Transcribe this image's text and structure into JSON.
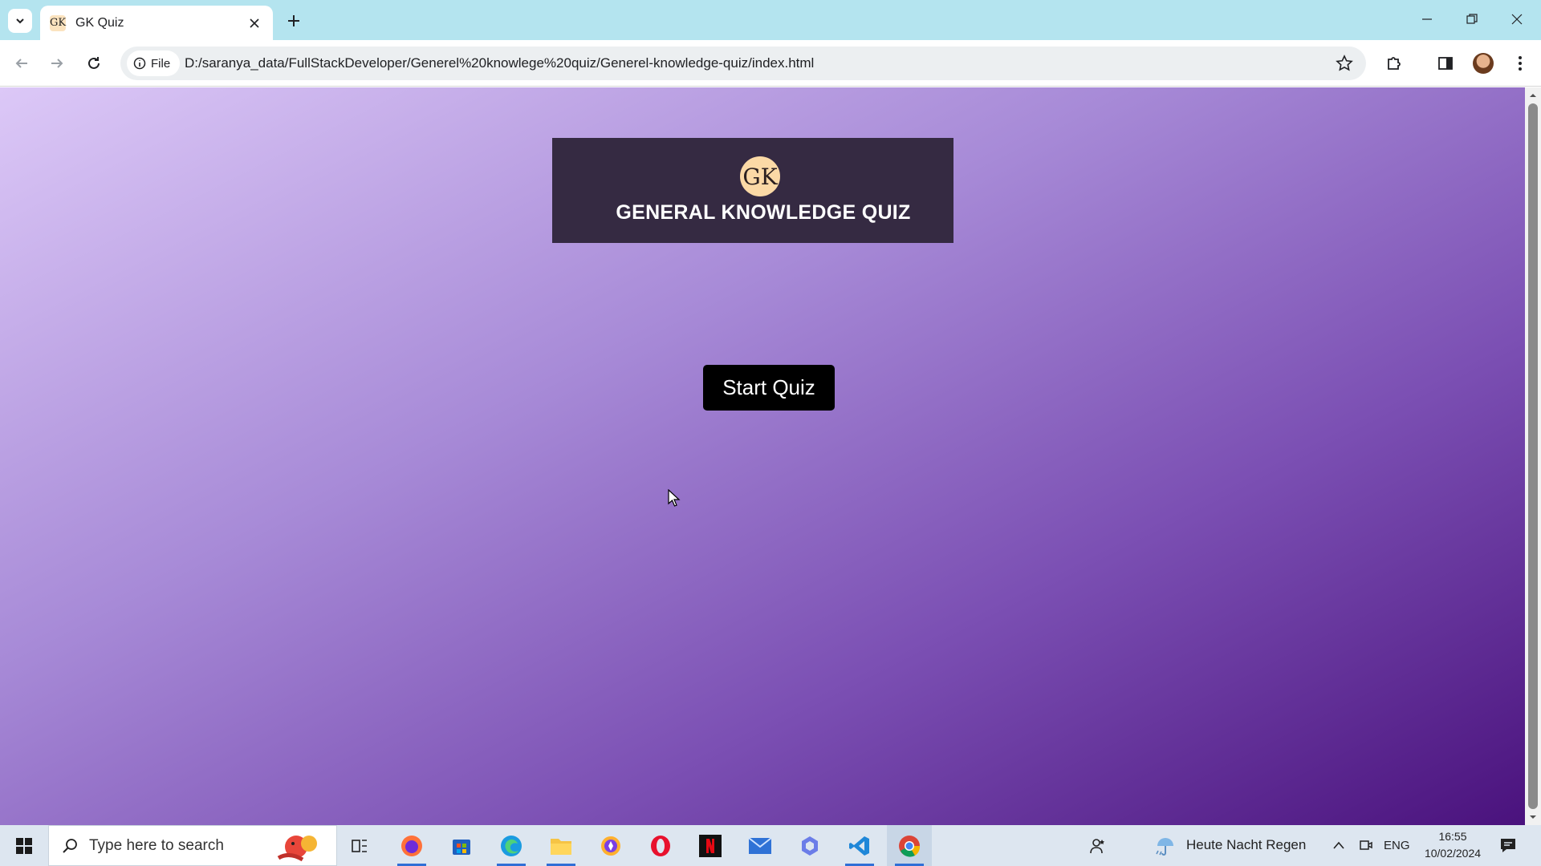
{
  "browser": {
    "tab_title": "GK Quiz",
    "tab_favicon": "GK",
    "address_chip": "File",
    "url": "D:/saranya_data/FullStackDeveloper/Generel%20knowlege%20quiz/Generel-knowledge-quiz/index.html"
  },
  "page": {
    "logo_text": "GK",
    "title": "GENERAL KNOWLEDGE QUIZ",
    "start_button": "Start Quiz"
  },
  "taskbar": {
    "search_placeholder": "Type here to search",
    "weather": "Heute Nacht Regen",
    "language": "ENG",
    "time": "16:55",
    "date": "10/02/2024"
  },
  "colors": {
    "tab_strip": "#b4e4ef",
    "header_card": "#352a42",
    "gradient_start": "#dcc8f7",
    "gradient_end": "#4a127d",
    "button": "#000000"
  }
}
